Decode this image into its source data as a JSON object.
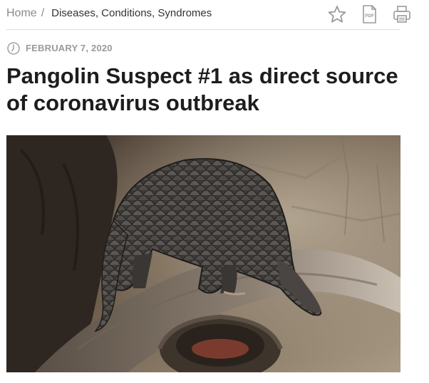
{
  "breadcrumb": {
    "home": "Home",
    "separator": "/",
    "current": "Diseases, Conditions, Syndromes"
  },
  "toolbar": {
    "icons": [
      "star-icon",
      "pdf-icon",
      "print-icon"
    ],
    "pdf_badge": "PDF"
  },
  "article": {
    "date": "FEBRUARY 7, 2020",
    "title": "Pangolin Suspect #1 as direct source of coronavirus outbreak"
  },
  "colors": {
    "title": "#1d1d1d",
    "meta": "#9a9a9a",
    "icon": "#9a9a9a",
    "divider": "#dcdcdc"
  }
}
